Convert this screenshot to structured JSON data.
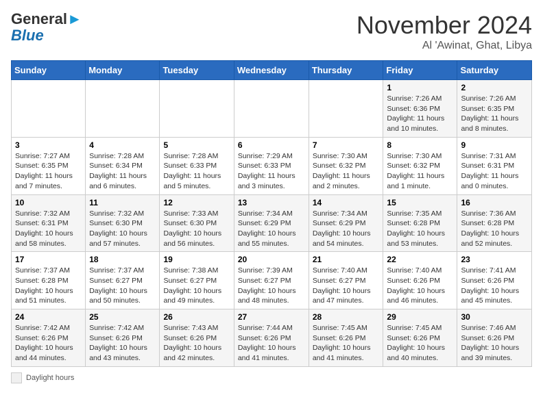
{
  "header": {
    "logo_line1": "General",
    "logo_line2": "Blue",
    "month": "November 2024",
    "location": "Al 'Awinat, Ghat, Libya"
  },
  "weekdays": [
    "Sunday",
    "Monday",
    "Tuesday",
    "Wednesday",
    "Thursday",
    "Friday",
    "Saturday"
  ],
  "weeks": [
    [
      {
        "day": "",
        "info": ""
      },
      {
        "day": "",
        "info": ""
      },
      {
        "day": "",
        "info": ""
      },
      {
        "day": "",
        "info": ""
      },
      {
        "day": "",
        "info": ""
      },
      {
        "day": "1",
        "info": "Sunrise: 7:26 AM\nSunset: 6:36 PM\nDaylight: 11 hours and 10 minutes."
      },
      {
        "day": "2",
        "info": "Sunrise: 7:26 AM\nSunset: 6:35 PM\nDaylight: 11 hours and 8 minutes."
      }
    ],
    [
      {
        "day": "3",
        "info": "Sunrise: 7:27 AM\nSunset: 6:35 PM\nDaylight: 11 hours and 7 minutes."
      },
      {
        "day": "4",
        "info": "Sunrise: 7:28 AM\nSunset: 6:34 PM\nDaylight: 11 hours and 6 minutes."
      },
      {
        "day": "5",
        "info": "Sunrise: 7:28 AM\nSunset: 6:33 PM\nDaylight: 11 hours and 5 minutes."
      },
      {
        "day": "6",
        "info": "Sunrise: 7:29 AM\nSunset: 6:33 PM\nDaylight: 11 hours and 3 minutes."
      },
      {
        "day": "7",
        "info": "Sunrise: 7:30 AM\nSunset: 6:32 PM\nDaylight: 11 hours and 2 minutes."
      },
      {
        "day": "8",
        "info": "Sunrise: 7:30 AM\nSunset: 6:32 PM\nDaylight: 11 hours and 1 minute."
      },
      {
        "day": "9",
        "info": "Sunrise: 7:31 AM\nSunset: 6:31 PM\nDaylight: 11 hours and 0 minutes."
      }
    ],
    [
      {
        "day": "10",
        "info": "Sunrise: 7:32 AM\nSunset: 6:31 PM\nDaylight: 10 hours and 58 minutes."
      },
      {
        "day": "11",
        "info": "Sunrise: 7:32 AM\nSunset: 6:30 PM\nDaylight: 10 hours and 57 minutes."
      },
      {
        "day": "12",
        "info": "Sunrise: 7:33 AM\nSunset: 6:30 PM\nDaylight: 10 hours and 56 minutes."
      },
      {
        "day": "13",
        "info": "Sunrise: 7:34 AM\nSunset: 6:29 PM\nDaylight: 10 hours and 55 minutes."
      },
      {
        "day": "14",
        "info": "Sunrise: 7:34 AM\nSunset: 6:29 PM\nDaylight: 10 hours and 54 minutes."
      },
      {
        "day": "15",
        "info": "Sunrise: 7:35 AM\nSunset: 6:28 PM\nDaylight: 10 hours and 53 minutes."
      },
      {
        "day": "16",
        "info": "Sunrise: 7:36 AM\nSunset: 6:28 PM\nDaylight: 10 hours and 52 minutes."
      }
    ],
    [
      {
        "day": "17",
        "info": "Sunrise: 7:37 AM\nSunset: 6:28 PM\nDaylight: 10 hours and 51 minutes."
      },
      {
        "day": "18",
        "info": "Sunrise: 7:37 AM\nSunset: 6:27 PM\nDaylight: 10 hours and 50 minutes."
      },
      {
        "day": "19",
        "info": "Sunrise: 7:38 AM\nSunset: 6:27 PM\nDaylight: 10 hours and 49 minutes."
      },
      {
        "day": "20",
        "info": "Sunrise: 7:39 AM\nSunset: 6:27 PM\nDaylight: 10 hours and 48 minutes."
      },
      {
        "day": "21",
        "info": "Sunrise: 7:40 AM\nSunset: 6:27 PM\nDaylight: 10 hours and 47 minutes."
      },
      {
        "day": "22",
        "info": "Sunrise: 7:40 AM\nSunset: 6:26 PM\nDaylight: 10 hours and 46 minutes."
      },
      {
        "day": "23",
        "info": "Sunrise: 7:41 AM\nSunset: 6:26 PM\nDaylight: 10 hours and 45 minutes."
      }
    ],
    [
      {
        "day": "24",
        "info": "Sunrise: 7:42 AM\nSunset: 6:26 PM\nDaylight: 10 hours and 44 minutes."
      },
      {
        "day": "25",
        "info": "Sunrise: 7:42 AM\nSunset: 6:26 PM\nDaylight: 10 hours and 43 minutes."
      },
      {
        "day": "26",
        "info": "Sunrise: 7:43 AM\nSunset: 6:26 PM\nDaylight: 10 hours and 42 minutes."
      },
      {
        "day": "27",
        "info": "Sunrise: 7:44 AM\nSunset: 6:26 PM\nDaylight: 10 hours and 41 minutes."
      },
      {
        "day": "28",
        "info": "Sunrise: 7:45 AM\nSunset: 6:26 PM\nDaylight: 10 hours and 41 minutes."
      },
      {
        "day": "29",
        "info": "Sunrise: 7:45 AM\nSunset: 6:26 PM\nDaylight: 10 hours and 40 minutes."
      },
      {
        "day": "30",
        "info": "Sunrise: 7:46 AM\nSunset: 6:26 PM\nDaylight: 10 hours and 39 minutes."
      }
    ]
  ],
  "footer": {
    "legend_label": "Daylight hours"
  }
}
